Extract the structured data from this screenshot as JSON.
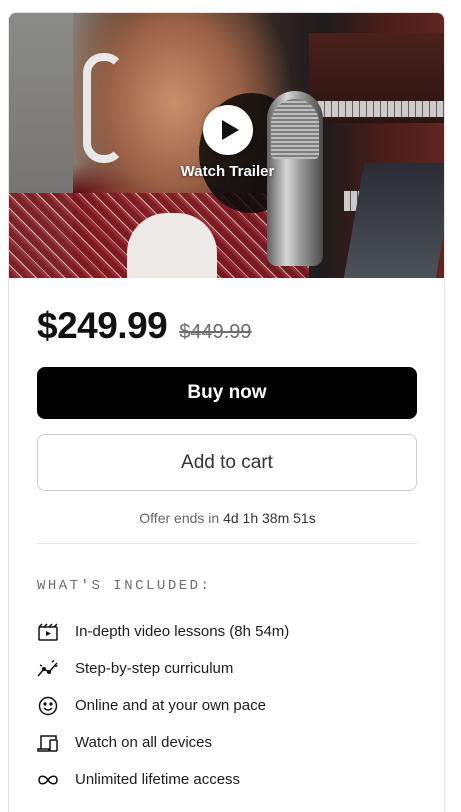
{
  "hero": {
    "trailer_label": "Watch Trailer",
    "play_icon": "play-icon"
  },
  "pricing": {
    "price": "$249.99",
    "original_price": "$449.99"
  },
  "actions": {
    "buy_label": "Buy now",
    "cart_label": "Add to cart"
  },
  "offer": {
    "prefix": "Offer ends in",
    "countdown": "4d 1h 38m 51s"
  },
  "included": {
    "title": "WHAT'S INCLUDED:",
    "items": [
      {
        "icon": "video-lessons-icon",
        "label": "In-depth video lessons (8h 54m)"
      },
      {
        "icon": "curriculum-icon",
        "label": "Step-by-step curriculum"
      },
      {
        "icon": "smiley-icon",
        "label": "Online and at your own pace"
      },
      {
        "icon": "devices-icon",
        "label": "Watch on all devices"
      },
      {
        "icon": "infinity-icon",
        "label": "Unlimited lifetime access"
      }
    ]
  },
  "colors": {
    "buy_button_bg": "#000000",
    "text": "#111111",
    "muted": "#6d6d6d"
  }
}
